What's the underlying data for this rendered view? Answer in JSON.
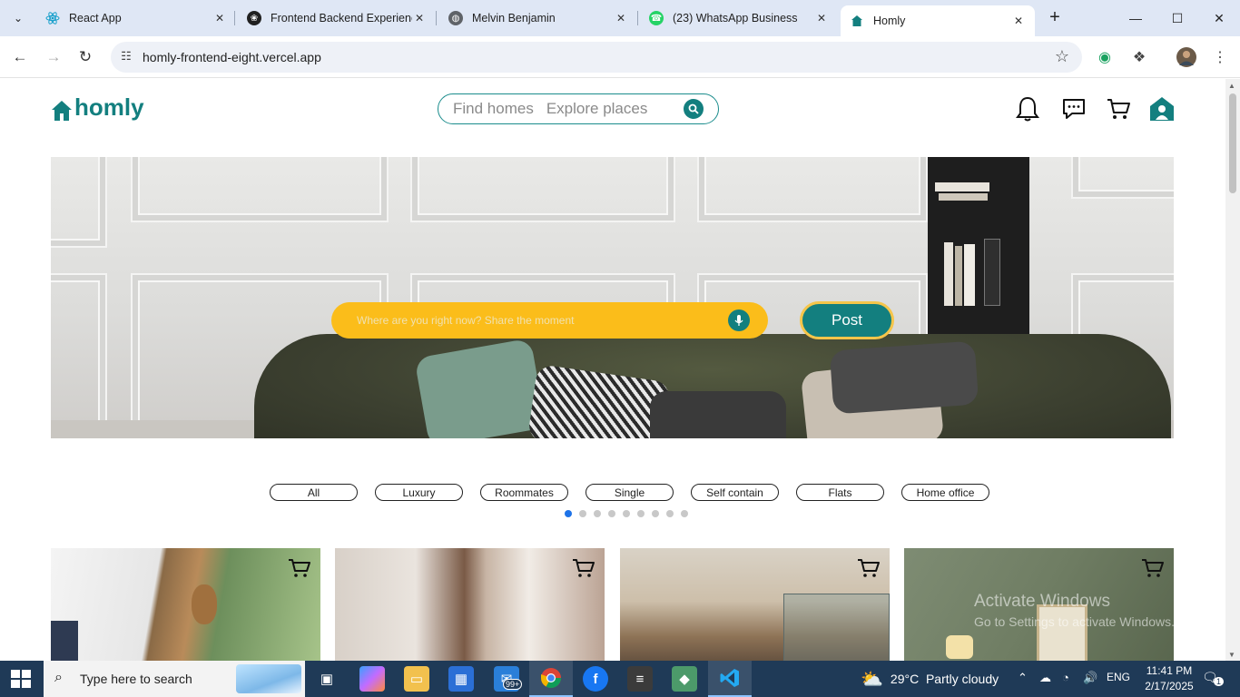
{
  "browser": {
    "tabs": [
      {
        "title": "React App",
        "favicon_color": "#61dafb",
        "active": false
      },
      {
        "title": "Frontend Backend Experienc",
        "favicon_color": "#202020",
        "active": false
      },
      {
        "title": "Melvin Benjamin",
        "favicon_color": "#5f6368",
        "active": false
      },
      {
        "title": "(23) WhatsApp Business",
        "favicon_color": "#25d366",
        "active": false
      },
      {
        "title": "Homly",
        "favicon_color": "#137f7f",
        "active": true
      }
    ],
    "url": "homly-frontend-eight.vercel.app"
  },
  "site": {
    "brand": "homly",
    "brand_color": "#137f7f",
    "search_placeholders": [
      "Find homes",
      "Explore places"
    ],
    "share_placeholder": "Where are you right now? Share the moment",
    "post_label": "Post",
    "accent_yellow": "#fbbd1a",
    "categories": [
      "All",
      "Luxury",
      "Roommates",
      "Single",
      "Self contain",
      "Flats",
      "Home office"
    ],
    "carousel": {
      "total": 9,
      "active": 0
    },
    "cards": [
      {
        "theme": "wood-ceiling-interior"
      },
      {
        "theme": "curtained-room"
      },
      {
        "theme": "open-plan-kitchen"
      },
      {
        "theme": "green-wall-art"
      }
    ]
  },
  "os": {
    "watermark_title": "Activate Windows",
    "watermark_sub": "Go to Settings to activate Windows.",
    "search_placeholder": "Type here to search",
    "mail_badge": "99+",
    "weather": "29°C  Partly cloudy",
    "language": "ENG",
    "time": "11:41 PM",
    "date": "2/17/2025",
    "notifications": "1"
  }
}
